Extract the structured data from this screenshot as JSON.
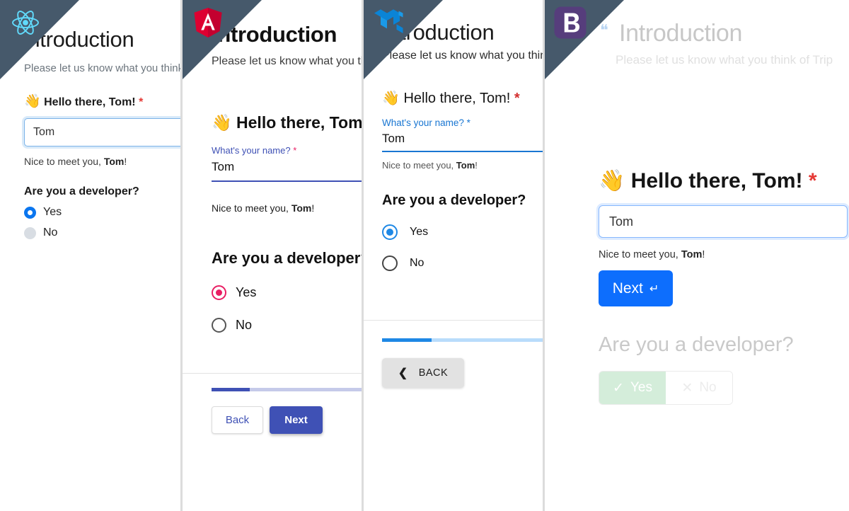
{
  "shared": {
    "title": "Introduction",
    "subtitle": "Please let us know what you think of Trip",
    "hello": "Hello there, Tom!",
    "wave_icon": "waving-hand-emoji",
    "required_mark": "*",
    "name_value": "Tom",
    "helper_prefix": "Nice to meet you, ",
    "helper_name": "Tom",
    "helper_suffix": "!",
    "developer_question": "Are you a developer?",
    "yes_label": "Yes",
    "no_label": "No",
    "name_question": "What's your name?"
  },
  "panels": [
    {
      "framework": "react",
      "logo_icon": "react-logo-icon",
      "accent": "#0b76ef",
      "ribbon_color": "#46596b",
      "selected_answer": "Yes"
    },
    {
      "framework": "angular",
      "logo_icon": "angular-logo-icon",
      "accent": "#3f51b5",
      "radio_color": "#e91e63",
      "ribbon_color": "#46596b",
      "selected_answer": "Yes",
      "back_label": "Back",
      "next_label": "Next",
      "progress_percent": 18
    },
    {
      "framework": "mui",
      "logo_icon": "mui-logo-icon",
      "accent": "#1976d2",
      "ribbon_color": "#46596b",
      "selected_answer": "Yes",
      "back_label": "BACK",
      "back_icon": "chevron-left-icon",
      "progress_percent": 28
    },
    {
      "framework": "bootstrap",
      "logo_icon": "bootstrap-logo-icon",
      "accent": "#0d6efd",
      "ribbon_color": "#46596b",
      "quote_icon": "quote-mark-icon",
      "selected_answer": "Yes",
      "next_label": "Next",
      "next_icon": "return-arrow-icon",
      "yes_icon": "check-icon",
      "no_icon": "cross-icon"
    }
  ]
}
